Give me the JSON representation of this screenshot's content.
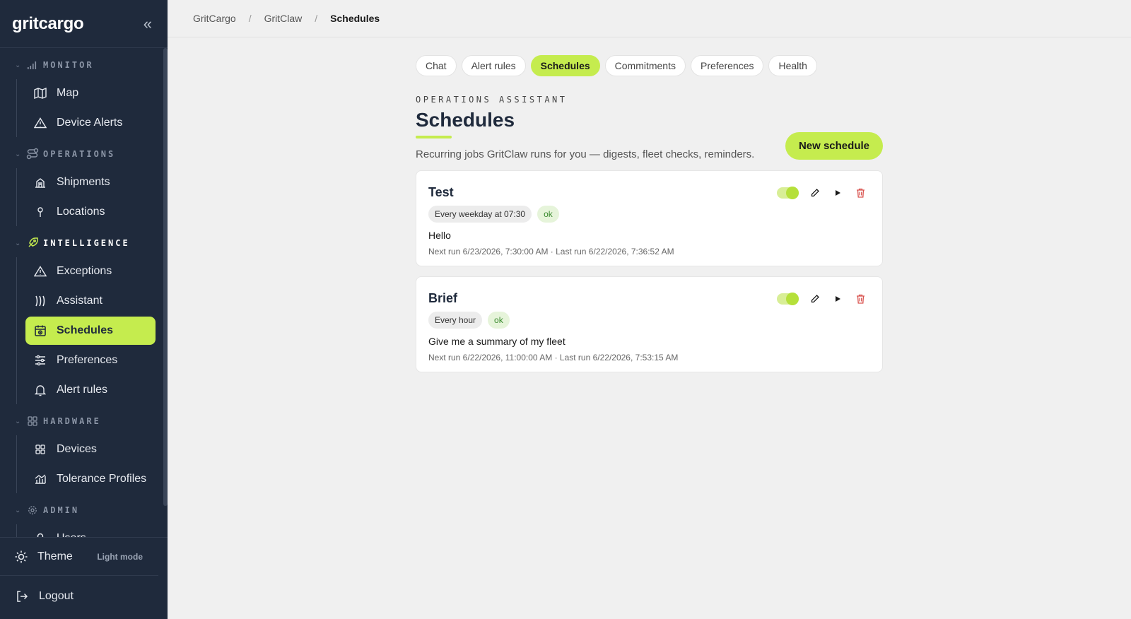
{
  "app": {
    "brand": "gritcargo"
  },
  "sidebar": {
    "sections": [
      {
        "title": "MONITOR",
        "icon": "signal-icon",
        "items": [
          {
            "label": "Map",
            "icon": "map-icon"
          },
          {
            "label": "Device Alerts",
            "icon": "warning-icon"
          }
        ]
      },
      {
        "title": "OPERATIONS",
        "icon": "route-icon",
        "items": [
          {
            "label": "Shipments",
            "icon": "shipments-icon"
          },
          {
            "label": "Locations",
            "icon": "location-pin-icon"
          }
        ]
      },
      {
        "title": "INTELLIGENCE",
        "icon": "rocket-icon",
        "items": [
          {
            "label": "Exceptions",
            "icon": "warning-icon"
          },
          {
            "label": "Assistant",
            "icon": "assistant-waves-icon"
          },
          {
            "label": "Schedules",
            "icon": "calendar-icon"
          },
          {
            "label": "Preferences",
            "icon": "sliders-icon"
          },
          {
            "label": "Alert rules",
            "icon": "bell-icon"
          }
        ]
      },
      {
        "title": "HARDWARE",
        "icon": "grid-icon",
        "items": [
          {
            "label": "Devices",
            "icon": "grid-icon"
          },
          {
            "label": "Tolerance Profiles",
            "icon": "chart-icon"
          }
        ]
      },
      {
        "title": "ADMIN",
        "icon": "gear-icon",
        "items": [
          {
            "label": "Users",
            "icon": "user-icon"
          }
        ]
      }
    ],
    "active_item": "Schedules",
    "theme_label": "Theme",
    "theme_mode": "Light mode",
    "logout_label": "Logout"
  },
  "breadcrumb": [
    "GritCargo",
    "GritClaw",
    "Schedules"
  ],
  "tabs": [
    "Chat",
    "Alert rules",
    "Schedules",
    "Commitments",
    "Preferences",
    "Health"
  ],
  "active_tab": "Schedules",
  "page": {
    "eyebrow": "OPERATIONS ASSISTANT",
    "title": "Schedules",
    "subtitle": "Recurring jobs GritClaw runs for you — digests, fleet checks, reminders.",
    "new_button": "New schedule"
  },
  "schedules": [
    {
      "name": "Test",
      "frequency": "Every weekday at 07:30",
      "status": "ok",
      "prompt": "Hello",
      "meta": "Next run 6/23/2026, 7:30:00 AM · Last run 6/22/2026, 7:36:52 AM",
      "enabled": true
    },
    {
      "name": "Brief",
      "frequency": "Every hour",
      "status": "ok",
      "prompt": "Give me a summary of my fleet",
      "meta": "Next run 6/22/2026, 11:00:00 AM · Last run 6/22/2026, 7:53:15 AM",
      "enabled": true
    }
  ],
  "colors": {
    "accent": "#c5ec4e",
    "sidebar_bg": "#1f2a3c",
    "danger": "#d9534f"
  }
}
